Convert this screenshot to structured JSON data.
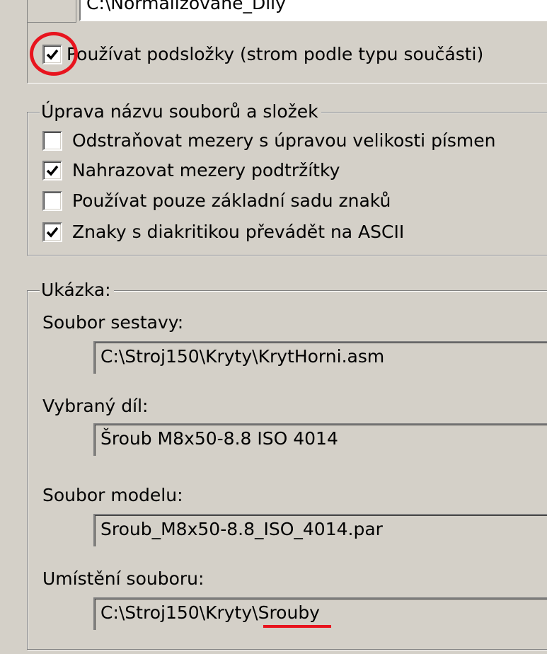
{
  "top_section": {
    "path_fragment": "C:\\Normalizovane_Dily",
    "use_subfolders": {
      "label": "Používat podsložky (strom podle typu součásti)",
      "checked": true
    }
  },
  "filename_group": {
    "legend": "Úprava názvu souborů a složek",
    "options": [
      {
        "label": "Odstraňovat mezery s úpravou velikosti písmen",
        "checked": false
      },
      {
        "label": "Nahrazovat mezery podtržítky",
        "checked": true
      },
      {
        "label": "Používat pouze základní sadu znaků",
        "checked": false
      },
      {
        "label": "Znaky s diakritikou převádět na ASCII",
        "checked": true
      }
    ]
  },
  "preview_group": {
    "legend": "Ukázka:",
    "assembly_file": {
      "label": "Soubor sestavy:",
      "value": "C:\\Stroj150\\Kryty\\KrytHorni.asm"
    },
    "selected_part": {
      "label": "Vybraný díl:",
      "value": "Šroub M8x50-8.8 ISO 4014"
    },
    "model_file": {
      "label": "Soubor modelu:",
      "value": "Sroub_M8x50-8.8_ISO_4014.par"
    },
    "file_location": {
      "label": "Umístění souboru:",
      "value_prefix": "C:\\Stroj150\\Kryty\\",
      "value_highlight": "Srouby"
    }
  },
  "annotations": {
    "highlight_color": "#e8141e"
  }
}
